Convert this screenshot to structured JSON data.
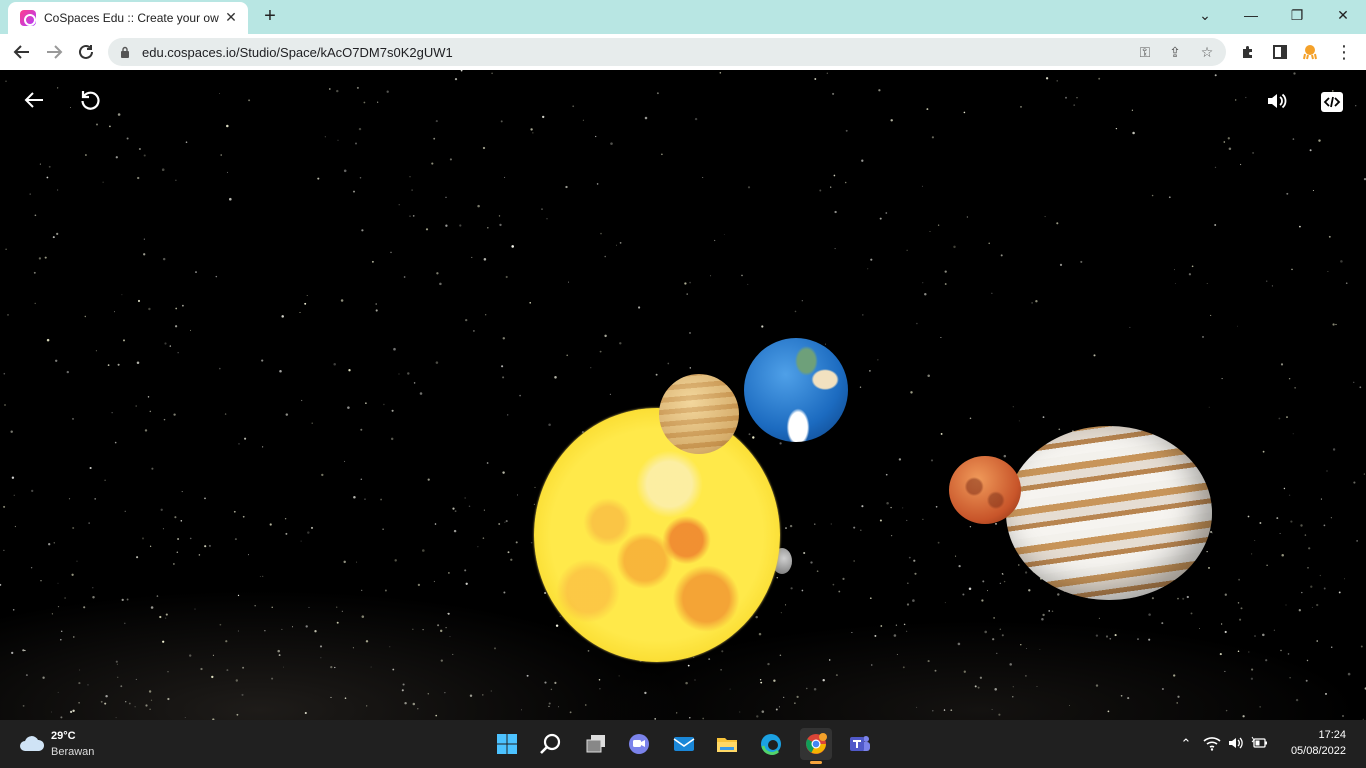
{
  "browser": {
    "tab": {
      "title": "CoSpaces Edu :: Create your own",
      "favicon": "cospaces-favicon-icon"
    },
    "new_tab_label": "+",
    "url": "edu.cospaces.io/Studio/Space/kAcO7DM7s0K2gUW1",
    "accent_color": "#b8e6e3"
  },
  "scene": {
    "description_icons": [
      "back-arrow-icon",
      "restart-icon",
      "volume-icon",
      "code-embed-icon"
    ],
    "planets": [
      "sun",
      "venus",
      "earth",
      "moon",
      "mars",
      "jupiter"
    ]
  },
  "taskbar": {
    "weather": {
      "temp": "29°C",
      "desc": "Berawan"
    },
    "clock": {
      "time": "17:24",
      "date": "05/08/2022"
    },
    "apps": [
      "start",
      "search",
      "task-view",
      "teams-chat",
      "mail",
      "file-explorer",
      "edge",
      "chrome",
      "teams"
    ]
  }
}
